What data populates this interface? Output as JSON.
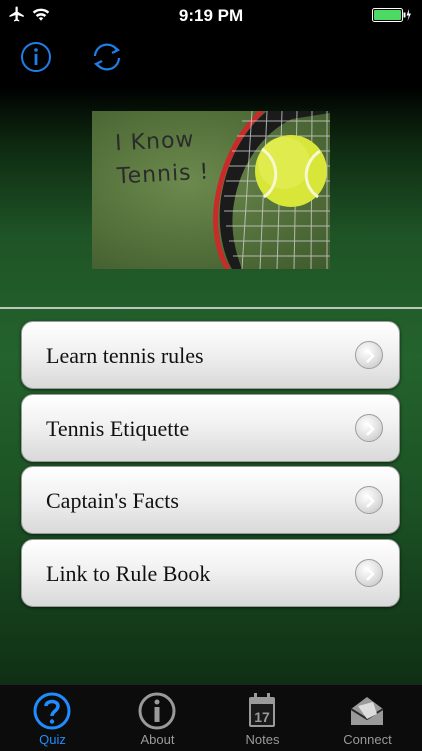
{
  "status_bar": {
    "time": "9:19 PM"
  },
  "nav": {
    "info_icon": "info-circle-icon",
    "refresh_icon": "refresh-icon"
  },
  "hero": {
    "line1": "I Know",
    "line2": "Tennis !"
  },
  "menu": [
    {
      "label": "Learn tennis rules"
    },
    {
      "label": "Tennis Etiquette"
    },
    {
      "label": "Captain's Facts"
    },
    {
      "label": "Link to Rule Book"
    }
  ],
  "tabs": [
    {
      "label": "Quiz",
      "icon": "question-icon",
      "active": true
    },
    {
      "label": "About",
      "icon": "info-icon",
      "active": false
    },
    {
      "label": "Notes",
      "icon": "calendar-icon",
      "badge": "17",
      "active": false
    },
    {
      "label": "Connect",
      "icon": "envelope-icon",
      "active": false
    }
  ],
  "colors": {
    "accent": "#1f8dff",
    "battery": "#4cd964"
  }
}
